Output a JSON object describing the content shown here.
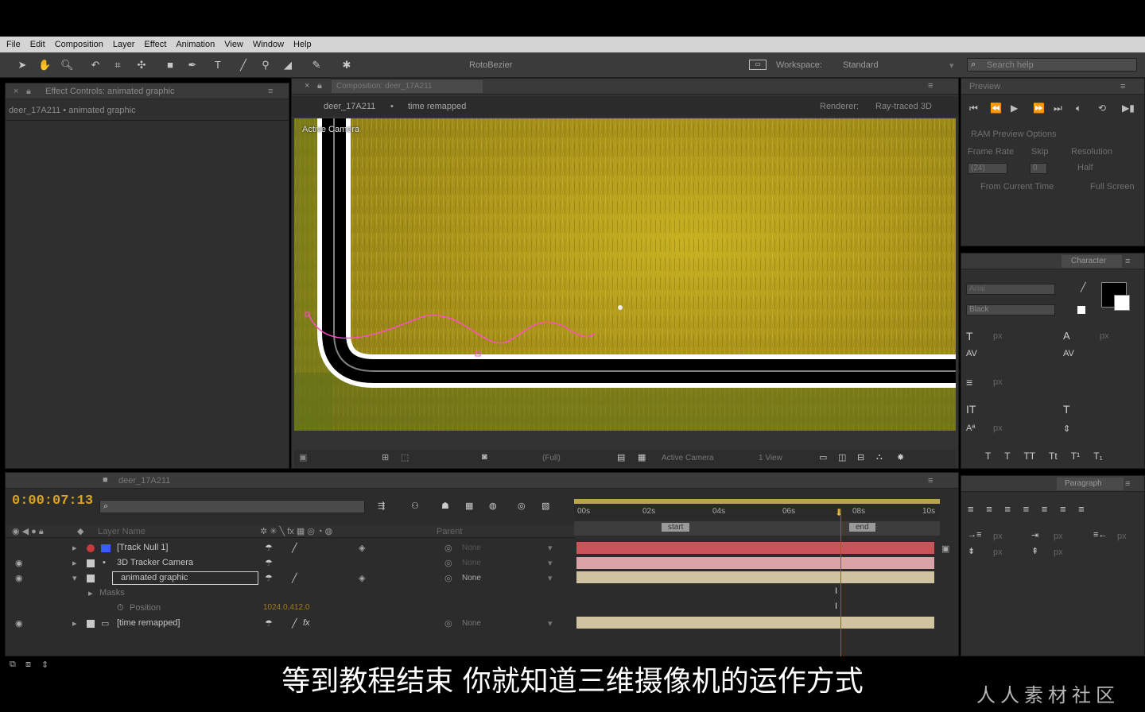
{
  "menu": [
    "File",
    "Edit",
    "Composition",
    "Layer",
    "Effect",
    "Animation",
    "View",
    "Window",
    "Help"
  ],
  "toolbar": {
    "rotobezier_label": "RotoBezier",
    "workspace_label": "Workspace:",
    "workspace_value": "Standard",
    "search_placeholder": "Search help"
  },
  "project_panel": {
    "tab_label": "Effect Controls: animated graphic",
    "breadcrumb": "deer_17A211 • animated graphic"
  },
  "comp_panel": {
    "tab_label": "Composition: deer_17A211",
    "subtab_comp": "deer_17A211",
    "subtab_layer": "time remapped",
    "renderer_label": "Renderer:",
    "renderer_value": "Ray-traced 3D",
    "active_camera_overlay": "Active Camera",
    "footer_zoom": "(Full)",
    "footer_camera": "Active Camera",
    "footer_views": "1 View"
  },
  "preview_panel": {
    "tab_label": "Preview",
    "ram_options": "RAM Preview Options",
    "frame_rate_label": "Frame Rate",
    "skip_label": "Skip",
    "resolution_label": "Resolution",
    "frame_rate_value": "(24)",
    "skip_value": "0",
    "resolution_value": "Half",
    "from_current_time": "From Current Time",
    "full_screen": "Full Screen"
  },
  "character_panel": {
    "tab_label": "Character",
    "font_family": "Arial",
    "font_style": "Black",
    "size_unit": "px",
    "text_fill": "#000000",
    "text_stroke": "#ffffff"
  },
  "paragraph_panel": {
    "tab_label": "Paragraph",
    "unit": "px"
  },
  "timeline": {
    "tab_label": "deer_17A211",
    "timecode": "0:00:07:13",
    "col_layer_name": "Layer Name",
    "col_parent": "Parent",
    "time_ticks": [
      "00s",
      "02s",
      "04s",
      "06s",
      "08s",
      "10s"
    ],
    "work_area_start": "start",
    "work_area_end": "end",
    "layers": [
      {
        "name": "[Track Null 1]",
        "label_color": "#3a5cff",
        "parent": "None",
        "bar_color": "#c9555a"
      },
      {
        "name": "3D Tracker Camera",
        "label_color": "#c8c8c8",
        "parent": "None",
        "bar_color": "#d9a3a8"
      },
      {
        "name": "animated graphic",
        "label_color": "#c8c8c8",
        "parent": "None",
        "bar_color": "#cfc3a2"
      },
      {
        "name": "Masks",
        "label_color": "",
        "parent": "",
        "bar_color": ""
      },
      {
        "name": "Position",
        "label_color": "",
        "parent": "",
        "bar_color": ""
      },
      {
        "name": "[time remapped]",
        "label_color": "#c8c8c8",
        "parent": "None",
        "bar_color": "#cfc3a2"
      }
    ],
    "position_value": "1024.0,412.0"
  },
  "subtitle": "等到教程结束 你就知道三维摄像机的运作方式",
  "watermark": "人人素材社区",
  "colors": {
    "panel_bg": "#2f2f2f",
    "menubar_bg": "#d4d4d4",
    "timecode": "#d9a323",
    "playhead": "#ff2a2a",
    "mask_path": "#ff4fc9"
  }
}
